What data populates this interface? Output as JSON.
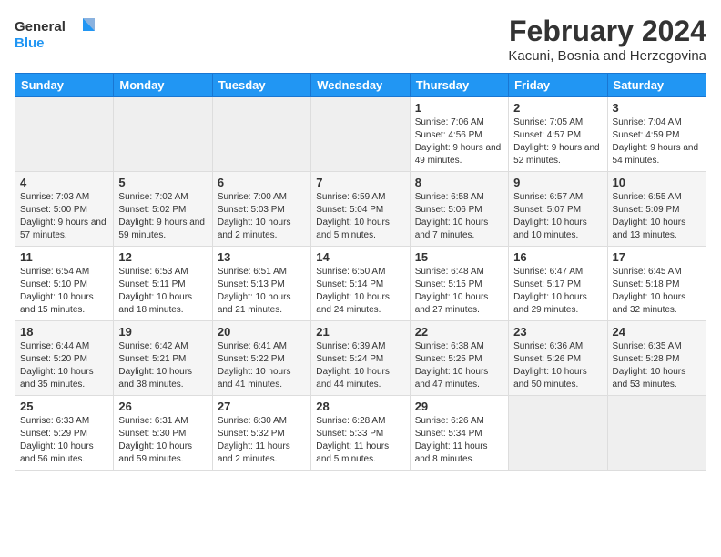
{
  "header": {
    "logo_line1": "General",
    "logo_line2": "Blue",
    "month": "February 2024",
    "location": "Kacuni, Bosnia and Herzegovina"
  },
  "weekdays": [
    "Sunday",
    "Monday",
    "Tuesday",
    "Wednesday",
    "Thursday",
    "Friday",
    "Saturday"
  ],
  "weeks": [
    [
      {
        "day": "",
        "sunrise": "",
        "sunset": "",
        "daylight": ""
      },
      {
        "day": "",
        "sunrise": "",
        "sunset": "",
        "daylight": ""
      },
      {
        "day": "",
        "sunrise": "",
        "sunset": "",
        "daylight": ""
      },
      {
        "day": "",
        "sunrise": "",
        "sunset": "",
        "daylight": ""
      },
      {
        "day": "1",
        "sunrise": "7:06 AM",
        "sunset": "4:56 PM",
        "daylight": "9 hours and 49 minutes."
      },
      {
        "day": "2",
        "sunrise": "7:05 AM",
        "sunset": "4:57 PM",
        "daylight": "9 hours and 52 minutes."
      },
      {
        "day": "3",
        "sunrise": "7:04 AM",
        "sunset": "4:59 PM",
        "daylight": "9 hours and 54 minutes."
      }
    ],
    [
      {
        "day": "4",
        "sunrise": "7:03 AM",
        "sunset": "5:00 PM",
        "daylight": "9 hours and 57 minutes."
      },
      {
        "day": "5",
        "sunrise": "7:02 AM",
        "sunset": "5:02 PM",
        "daylight": "9 hours and 59 minutes."
      },
      {
        "day": "6",
        "sunrise": "7:00 AM",
        "sunset": "5:03 PM",
        "daylight": "10 hours and 2 minutes."
      },
      {
        "day": "7",
        "sunrise": "6:59 AM",
        "sunset": "5:04 PM",
        "daylight": "10 hours and 5 minutes."
      },
      {
        "day": "8",
        "sunrise": "6:58 AM",
        "sunset": "5:06 PM",
        "daylight": "10 hours and 7 minutes."
      },
      {
        "day": "9",
        "sunrise": "6:57 AM",
        "sunset": "5:07 PM",
        "daylight": "10 hours and 10 minutes."
      },
      {
        "day": "10",
        "sunrise": "6:55 AM",
        "sunset": "5:09 PM",
        "daylight": "10 hours and 13 minutes."
      }
    ],
    [
      {
        "day": "11",
        "sunrise": "6:54 AM",
        "sunset": "5:10 PM",
        "daylight": "10 hours and 15 minutes."
      },
      {
        "day": "12",
        "sunrise": "6:53 AM",
        "sunset": "5:11 PM",
        "daylight": "10 hours and 18 minutes."
      },
      {
        "day": "13",
        "sunrise": "6:51 AM",
        "sunset": "5:13 PM",
        "daylight": "10 hours and 21 minutes."
      },
      {
        "day": "14",
        "sunrise": "6:50 AM",
        "sunset": "5:14 PM",
        "daylight": "10 hours and 24 minutes."
      },
      {
        "day": "15",
        "sunrise": "6:48 AM",
        "sunset": "5:15 PM",
        "daylight": "10 hours and 27 minutes."
      },
      {
        "day": "16",
        "sunrise": "6:47 AM",
        "sunset": "5:17 PM",
        "daylight": "10 hours and 29 minutes."
      },
      {
        "day": "17",
        "sunrise": "6:45 AM",
        "sunset": "5:18 PM",
        "daylight": "10 hours and 32 minutes."
      }
    ],
    [
      {
        "day": "18",
        "sunrise": "6:44 AM",
        "sunset": "5:20 PM",
        "daylight": "10 hours and 35 minutes."
      },
      {
        "day": "19",
        "sunrise": "6:42 AM",
        "sunset": "5:21 PM",
        "daylight": "10 hours and 38 minutes."
      },
      {
        "day": "20",
        "sunrise": "6:41 AM",
        "sunset": "5:22 PM",
        "daylight": "10 hours and 41 minutes."
      },
      {
        "day": "21",
        "sunrise": "6:39 AM",
        "sunset": "5:24 PM",
        "daylight": "10 hours and 44 minutes."
      },
      {
        "day": "22",
        "sunrise": "6:38 AM",
        "sunset": "5:25 PM",
        "daylight": "10 hours and 47 minutes."
      },
      {
        "day": "23",
        "sunrise": "6:36 AM",
        "sunset": "5:26 PM",
        "daylight": "10 hours and 50 minutes."
      },
      {
        "day": "24",
        "sunrise": "6:35 AM",
        "sunset": "5:28 PM",
        "daylight": "10 hours and 53 minutes."
      }
    ],
    [
      {
        "day": "25",
        "sunrise": "6:33 AM",
        "sunset": "5:29 PM",
        "daylight": "10 hours and 56 minutes."
      },
      {
        "day": "26",
        "sunrise": "6:31 AM",
        "sunset": "5:30 PM",
        "daylight": "10 hours and 59 minutes."
      },
      {
        "day": "27",
        "sunrise": "6:30 AM",
        "sunset": "5:32 PM",
        "daylight": "11 hours and 2 minutes."
      },
      {
        "day": "28",
        "sunrise": "6:28 AM",
        "sunset": "5:33 PM",
        "daylight": "11 hours and 5 minutes."
      },
      {
        "day": "29",
        "sunrise": "6:26 AM",
        "sunset": "5:34 PM",
        "daylight": "11 hours and 8 minutes."
      },
      {
        "day": "",
        "sunrise": "",
        "sunset": "",
        "daylight": ""
      },
      {
        "day": "",
        "sunrise": "",
        "sunset": "",
        "daylight": ""
      }
    ]
  ],
  "labels": {
    "sunrise": "Sunrise:",
    "sunset": "Sunset:",
    "daylight": "Daylight:"
  }
}
